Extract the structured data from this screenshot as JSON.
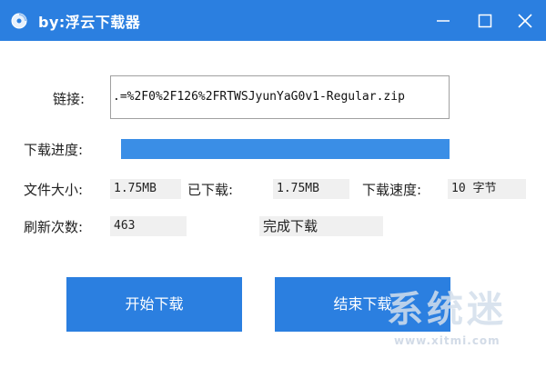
{
  "window": {
    "title": "by:浮云下载器",
    "icons": {
      "app": "disc-icon",
      "minimize": "minimize-icon",
      "maximize": "maximize-icon",
      "close": "close-icon"
    },
    "accent_color": "#2b7fe0"
  },
  "link": {
    "label": "链接:",
    "value": ".=%2F0%2F126%2FRTWSJyunYaG0v1-Regular.zip"
  },
  "progress": {
    "label": "下载进度:",
    "fraction": 1.0
  },
  "stats": {
    "file_size_label": "文件大小:",
    "file_size_value": "1.75MB",
    "downloaded_label": "已下载:",
    "downloaded_value": "1.75MB",
    "speed_label": "下载速度:",
    "speed_value": "10 字节",
    "refresh_label": "刷新次数:",
    "refresh_value": "463",
    "status_text": "完成下载"
  },
  "buttons": {
    "start_label": "开始下载",
    "stop_label": "结束下载"
  },
  "watermark": {
    "text": "系统迷",
    "url": "www.xitmi.com"
  }
}
